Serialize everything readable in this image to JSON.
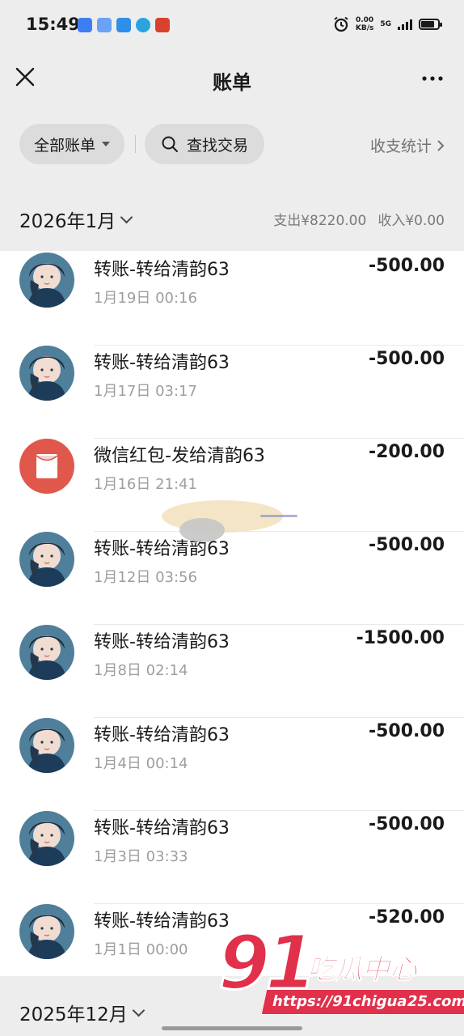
{
  "status_bar": {
    "time": "15:49",
    "net_speed_value": "0.00",
    "net_speed_unit": "KB/s",
    "network": "5G"
  },
  "nav": {
    "title": "账单",
    "close_icon": "close-icon",
    "more_icon": "more-dots-icon"
  },
  "filters": {
    "all_bills_label": "全部账单",
    "search_label": "查找交易",
    "stats_label": "收支统计"
  },
  "month": {
    "label": "2026年1月",
    "expense": "支出¥8220.00",
    "income": "收入¥0.00"
  },
  "transactions": [
    {
      "title": "转账-转给清韵63",
      "time": "1月19日 00:16",
      "amount": "-500.00",
      "type": "transfer"
    },
    {
      "title": "转账-转给清韵63",
      "time": "1月17日 03:17",
      "amount": "-500.00",
      "type": "transfer"
    },
    {
      "title": "微信红包-发给清韵63",
      "time": "1月16日 21:41",
      "amount": "-200.00",
      "type": "red-packet"
    },
    {
      "title": "转账-转给清韵63",
      "time": "1月12日 03:56",
      "amount": "-500.00",
      "type": "transfer"
    },
    {
      "title": "转账-转给清韵63",
      "time": "1月8日 02:14",
      "amount": "-1500.00",
      "type": "transfer"
    },
    {
      "title": "转账-转给清韵63",
      "time": "1月4日 00:14",
      "amount": "-500.00",
      "type": "transfer"
    },
    {
      "title": "转账-转给清韵63",
      "time": "1月3日 03:33",
      "amount": "-500.00",
      "type": "transfer"
    },
    {
      "title": "转账-转给清韵63",
      "time": "1月1日 00:00",
      "amount": "-520.00",
      "type": "transfer"
    }
  ],
  "next_month": {
    "label": "2025年12月"
  },
  "watermark": {
    "number": "91",
    "name": "吃瓜中心",
    "url": "https://91chigua25.com"
  },
  "colors": {
    "background": "#ededed",
    "list_background": "#ffffff",
    "red_packet": "#e0584b",
    "watermark": "#e0304a"
  }
}
